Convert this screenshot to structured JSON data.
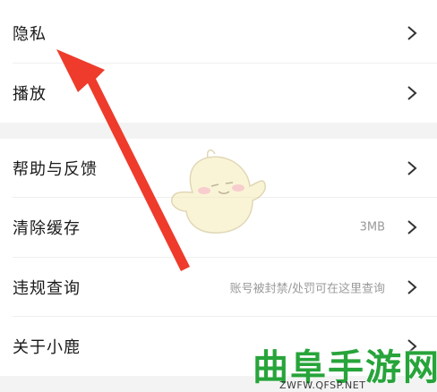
{
  "settings": {
    "rows": [
      {
        "label": "隐私",
        "value": ""
      },
      {
        "label": "播放",
        "value": ""
      },
      {
        "label": "帮助与反馈",
        "value": ""
      },
      {
        "label": "清除缓存",
        "value": "3MB"
      },
      {
        "label": "违规查询",
        "value": "账号被封禁/处罚可在这里查询"
      },
      {
        "label": "关于小鹿",
        "value": ""
      }
    ]
  },
  "watermark": {
    "brand": "曲阜手游网",
    "url": "ZWFW.QFSP.NET"
  },
  "colors": {
    "arrow": "#ee3b2b",
    "watermark_green": "#27a43a",
    "chevron": "#333333",
    "gap": "#f3f3f3"
  },
  "icons": {
    "chevron": "chevron-right-icon",
    "arrow": "red-arrow",
    "mascot": "chick-mascot"
  }
}
